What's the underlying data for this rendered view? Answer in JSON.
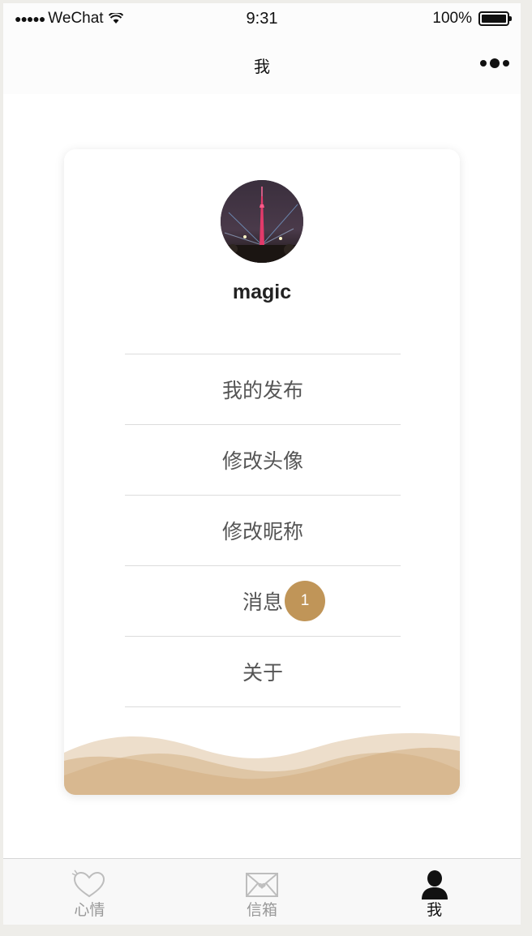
{
  "status_bar": {
    "signal": "●●●●●",
    "carrier": "WeChat",
    "time": "9:31",
    "battery": "100%"
  },
  "nav": {
    "title": "我"
  },
  "profile": {
    "username": "magic",
    "avatar_icon": "avatar-photo"
  },
  "menu": {
    "items": [
      {
        "label": "我的发布"
      },
      {
        "label": "修改头像"
      },
      {
        "label": "修改昵称"
      },
      {
        "label": "消息",
        "badge": "1"
      },
      {
        "label": "关于"
      }
    ]
  },
  "tabs": [
    {
      "label": "心情",
      "icon": "heart-icon",
      "active": false
    },
    {
      "label": "信箱",
      "icon": "mail-icon",
      "active": false
    },
    {
      "label": "我",
      "icon": "person-icon",
      "active": true
    }
  ],
  "colors": {
    "accent": "#c09558",
    "wave": "#d6b58c",
    "active_tab": "#111111",
    "inactive_tab": "#999999"
  }
}
